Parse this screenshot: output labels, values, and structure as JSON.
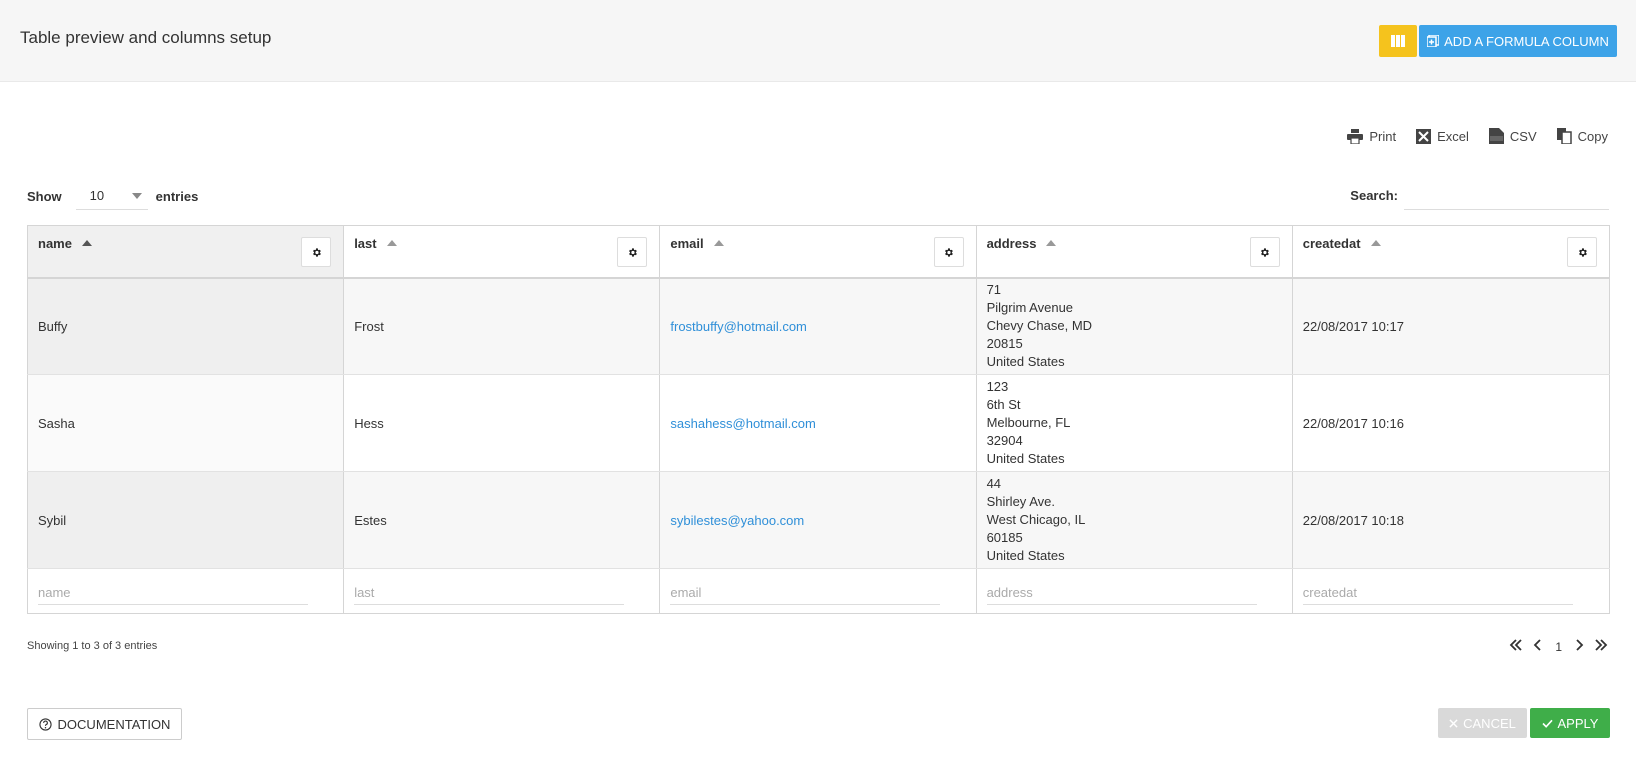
{
  "header": {
    "title": "Table preview and columns setup",
    "columns_icon": "columns-icon",
    "formula_button": "ADD A FORMULA COLUMN",
    "formula_icon": "add-formula-icon"
  },
  "export": {
    "print": "Print",
    "excel": "Excel",
    "csv": "CSV",
    "copy": "Copy"
  },
  "length": {
    "show_label": "Show",
    "value": "10",
    "entries_label": "entries"
  },
  "search": {
    "label": "Search:",
    "value": ""
  },
  "table": {
    "columns": [
      {
        "label": "name"
      },
      {
        "label": "last"
      },
      {
        "label": "email"
      },
      {
        "label": "address"
      },
      {
        "label": "createdat"
      }
    ],
    "rows": [
      {
        "name": "Buffy",
        "last": "Frost",
        "email": "frostbuffy@hotmail.com",
        "address": [
          "71",
          "Pilgrim Avenue",
          "Chevy Chase, MD",
          "20815",
          "United States"
        ],
        "createdat": "22/08/2017 10:17"
      },
      {
        "name": "Sasha",
        "last": "Hess",
        "email": "sashahess@hotmail.com",
        "address": [
          "123",
          "6th St",
          "Melbourne, FL",
          "32904",
          "United States"
        ],
        "createdat": "22/08/2017 10:16"
      },
      {
        "name": "Sybil",
        "last": "Estes",
        "email": "sybilestes@yahoo.com",
        "address": [
          "44",
          "Shirley Ave.",
          "West Chicago, IL",
          "60185",
          "United States"
        ],
        "createdat": "22/08/2017 10:18"
      }
    ],
    "filter_placeholders": [
      "name",
      "last",
      "email",
      "address",
      "createdat"
    ]
  },
  "info": "Showing 1 to 3 of 3 entries",
  "pagination": {
    "current_page": "1"
  },
  "footer": {
    "documentation": "DOCUMENTATION",
    "cancel": "CANCEL",
    "apply": "APPLY"
  },
  "colors": {
    "columns_button": "#f5c31d",
    "formula_button": "#3da3e8",
    "apply_button": "#3fae49",
    "cancel_button": "#d9d9d9",
    "link": "#2f8fd8"
  }
}
